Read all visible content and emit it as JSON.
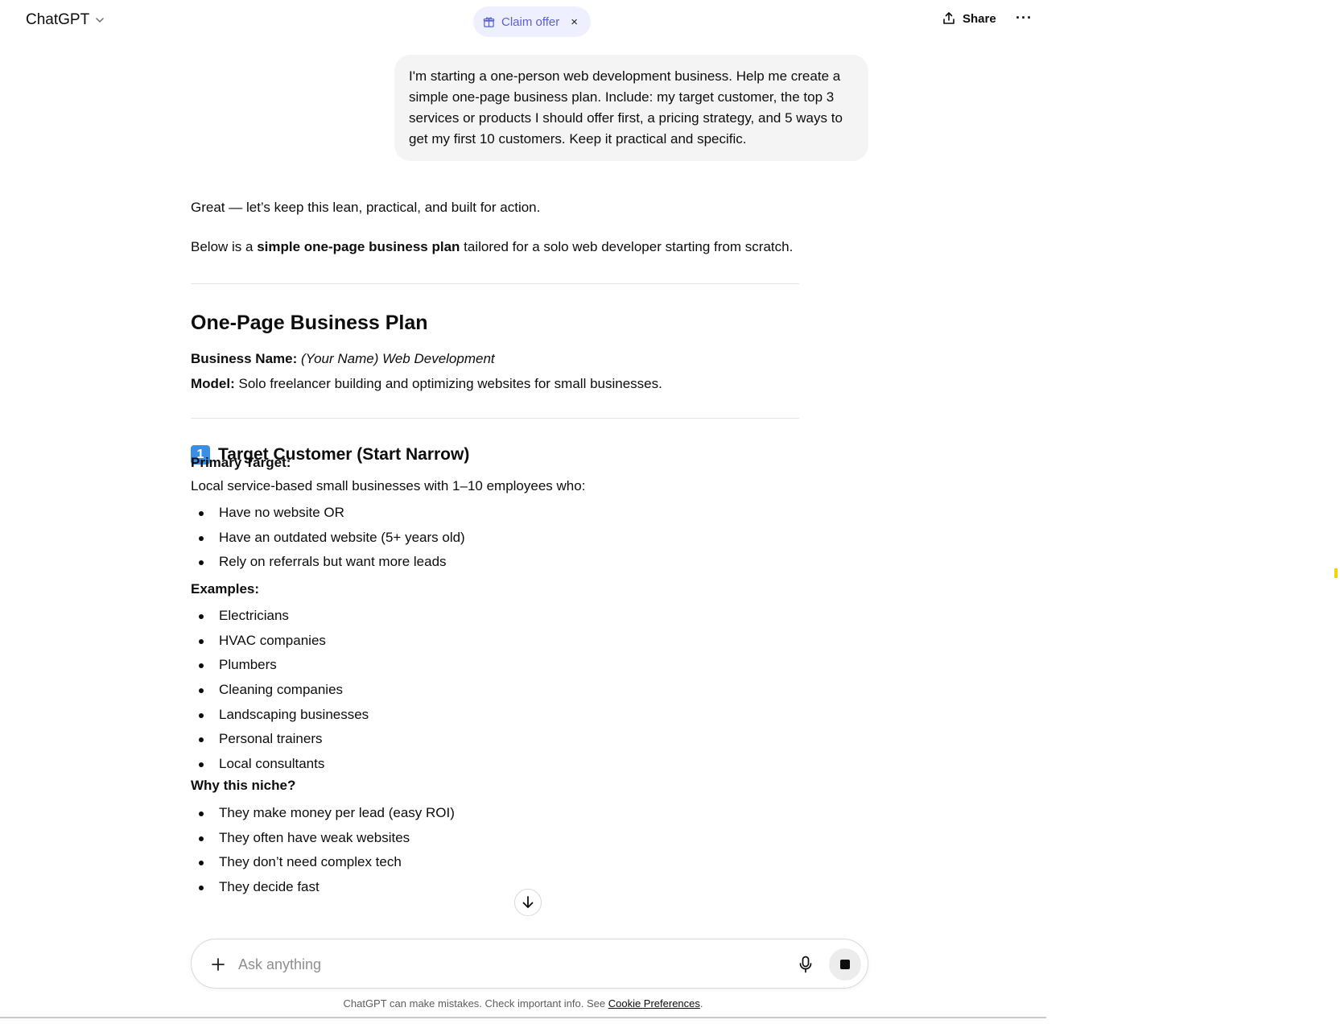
{
  "header": {
    "model_label": "ChatGPT",
    "claim_offer_label": "Claim offer",
    "claim_offer_close": "×",
    "share_label": "Share",
    "more_label": "···"
  },
  "conversation": {
    "user_message": "I'm starting a one-person web development business. Help me create a simple one-page business plan. Include: my target customer, the top 3 services or products I should offer first, a pricing strategy, and 5 ways to get my first 10 customers. Keep it practical and specific.",
    "assistant": {
      "intro": "Great — let’s keep this lean, practical, and built for action.",
      "below_prefix": "Below is a ",
      "below_bold": "simple one-page business plan",
      "below_suffix": " tailored for a solo web developer starting from scratch.",
      "title": "One-Page Business Plan",
      "business_name_label": "Business Name:",
      "business_name_value": "(Your Name) Web Development",
      "model_label": "Model:",
      "model_value": "Solo freelancer building and optimizing websites for small businesses.",
      "section1": {
        "badge": "1",
        "title": "Target Customer (Start Narrow)",
        "primary_label": "Primary Target:",
        "primary_desc": "Local service-based small businesses with 1–10 employees who:",
        "criteria": [
          "Have no website OR",
          "Have an outdated website (5+ years old)",
          "Rely on referrals but want more leads"
        ],
        "examples_label": "Examples:",
        "examples": [
          "Electricians",
          "HVAC companies",
          "Plumbers",
          "Cleaning companies",
          "Landscaping businesses",
          "Personal trainers",
          "Local consultants"
        ],
        "why_label": "Why this niche?",
        "why": [
          "They make money per lead (easy ROI)",
          "They often have weak websites",
          "They don’t need complex tech",
          "They decide fast"
        ]
      }
    }
  },
  "composer": {
    "placeholder": "Ask anything",
    "value": ""
  },
  "footer": {
    "disclaimer_prefix": "ChatGPT can make mistakes. Check important info. See ",
    "cookie_link": "Cookie Preferences",
    "disclaimer_suffix": "."
  },
  "colors": {
    "claim_offer_bg": "#eef0ff",
    "claim_offer_text": "#5b5fd6",
    "user_bubble_bg": "#f4f4f4",
    "badge_blue": "#3a8ee6"
  },
  "icons": {
    "chevron": "chevron-down-icon",
    "gift": "gift-icon",
    "share": "share-icon",
    "scroll": "arrow-down-icon",
    "plus": "plus-icon",
    "mic": "microphone-icon",
    "stop": "stop-icon"
  }
}
